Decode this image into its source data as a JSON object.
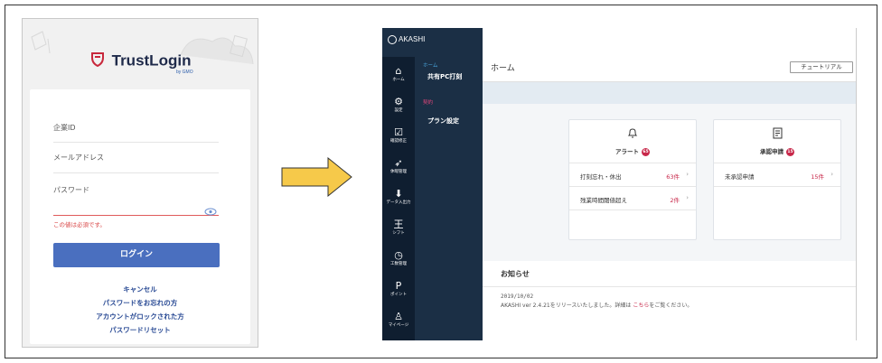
{
  "trustlogin": {
    "logo_text": "TrustLogin",
    "logo_sub": "by GMO",
    "fields": [
      {
        "label": "企業ID"
      },
      {
        "label": "メールアドレス"
      },
      {
        "label": "パスワード"
      }
    ],
    "error_text": "この値は必須です。",
    "login_button": "ログイン",
    "links": [
      "キャンセル",
      "パスワードをお忘れの方",
      "アカウントがロックされた方",
      "パスワードリセット"
    ],
    "colors": {
      "primary": "#4a6fbf",
      "error": "#d84444",
      "logo_red": "#c8283c"
    }
  },
  "arrow": {
    "color": "#f6c94a"
  },
  "akashi": {
    "brand": "AKASHI",
    "nav": [
      {
        "icon": "home-icon",
        "glyph": "⌂",
        "label": "ホーム"
      },
      {
        "icon": "gear-icon",
        "glyph": "⚙",
        "label": "設定"
      },
      {
        "icon": "clipboard-icon",
        "glyph": "☑",
        "label": "確認修正"
      },
      {
        "icon": "plane-icon",
        "glyph": "➶",
        "label": "休暇管理"
      },
      {
        "icon": "download-icon",
        "glyph": "⬇",
        "label": "データ入出力"
      },
      {
        "icon": "shift-icon",
        "glyph": "王",
        "label": "シフト"
      },
      {
        "icon": "clock-icon",
        "glyph": "◷",
        "label": "工数管理"
      },
      {
        "icon": "p-icon",
        "glyph": "P",
        "label": "ポイント"
      },
      {
        "icon": "user-icon",
        "glyph": "♙",
        "label": "マイページ"
      }
    ],
    "submenu": [
      {
        "section": "ホーム",
        "section_color": "#4aa8e0",
        "item": "共有PC打刻"
      },
      {
        "section": "契約",
        "section_color": "#e0457a",
        "item": "プラン設定"
      }
    ],
    "page_title": "ホーム",
    "tutorial_button": "チュートリアル",
    "alert_card": {
      "icon": "bell-icon",
      "title": "アラート",
      "badge": "65",
      "rows": [
        {
          "label": "打刻忘れ・休出",
          "value": "63件"
        },
        {
          "label": "残業時間閾値超え",
          "value": "2件"
        }
      ]
    },
    "approval_card": {
      "icon": "document-icon",
      "title": "承認申請",
      "badge": "15",
      "rows": [
        {
          "label": "未承認申請",
          "value": "15件"
        }
      ]
    },
    "news": {
      "title": "お知らせ",
      "date": "2019/10/02",
      "text": "AKASHI ver 2.4.21をリリースいたしました。詳細は",
      "link": "こちら",
      "text_after": "をご覧ください。"
    }
  }
}
